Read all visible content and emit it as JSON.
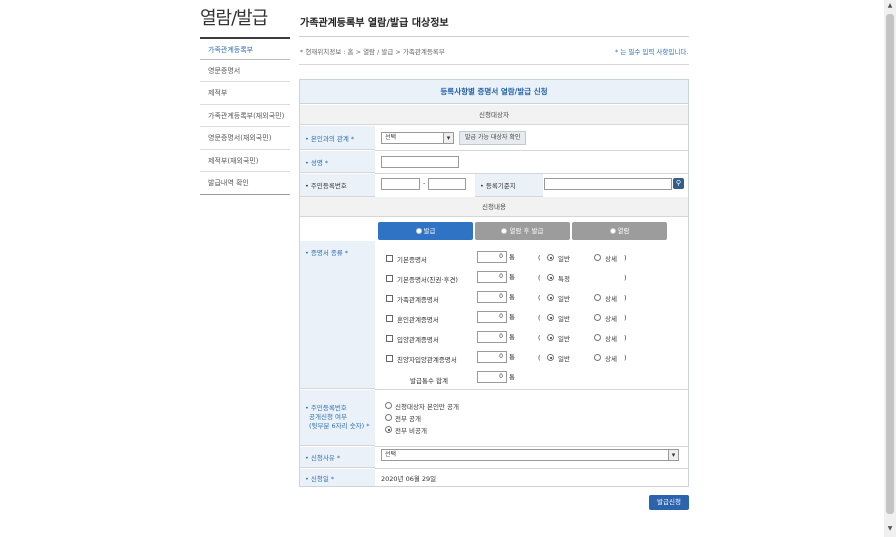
{
  "sidebar": {
    "title": "열람/발급",
    "items": [
      {
        "label": "가족관계등록부"
      },
      {
        "label": "영문증명서"
      },
      {
        "label": "제적부"
      },
      {
        "label": "가족관계등록부(재외국민)"
      },
      {
        "label": "영문증명서(재외국민)"
      },
      {
        "label": "제적부(재외국민)"
      },
      {
        "label": "발급내역 확인"
      }
    ]
  },
  "header": {
    "title": "가족관계등록부 열람/발급 대상정보",
    "breadcrumb": "* 현재위치정보 : 홈 > 열람 / 발급 > 가족관계등록부",
    "required_note": "* 는 필수 입력 사항입니다."
  },
  "form": {
    "title": "등록사항별 증명서 열람/발급 신청",
    "applicant_section": "신청대상자",
    "relation_label": "• 본인과의 관계 *",
    "relation_value": "선택",
    "check_target_button": "발급 가능 대상자 확인",
    "name_label": "• 성명 *",
    "rrn_label": "• 주민등록번호",
    "rrn_dash": "-",
    "reg_base_label": "• 등록기준지",
    "content_section": "신청내용",
    "tabs": [
      {
        "label": "발급"
      },
      {
        "label": "열람 후 발급"
      },
      {
        "label": "열람"
      }
    ],
    "cert_type_label": "• 증명서 종류 *",
    "unit": "통",
    "paren_open": "(",
    "paren_close": ")",
    "option_general": "일반",
    "option_detail": "상세",
    "option_specific": "특정",
    "certs": [
      {
        "name": "기본증명서",
        "count": "0",
        "opt1": "일반",
        "opt2": "상세"
      },
      {
        "name": "기본증명서(친권·후견)",
        "count": "0",
        "opt1": "특정",
        "opt2": ""
      },
      {
        "name": "가족관계증명서",
        "count": "0",
        "opt1": "일반",
        "opt2": "상세"
      },
      {
        "name": "혼인관계증명서",
        "count": "0",
        "opt1": "일반",
        "opt2": "상세"
      },
      {
        "name": "입양관계증명서",
        "count": "0",
        "opt1": "일반",
        "opt2": "상세"
      },
      {
        "name": "친양자입양관계증명서",
        "count": "0",
        "opt1": "일반",
        "opt2": "상세"
      }
    ],
    "total_label": "발급통수 합계",
    "total_count": "0",
    "disclosure_label_1": "• 주민등록번호",
    "disclosure_label_2": "공개신청 여부",
    "disclosure_label_3": "(뒷부분 6자리 숫자) *",
    "disclosure_options": [
      {
        "label": "신청대상자 본인만 공개",
        "selected": false
      },
      {
        "label": "전부 공개",
        "selected": false
      },
      {
        "label": "전부 비공개",
        "selected": true
      }
    ],
    "reason_label": "• 신청사유 *",
    "reason_value": "선택",
    "date_label": "• 신청일 *",
    "date_value": "2020년 06월 29일",
    "submit_button": "발급신청"
  },
  "icons": {
    "search": "search-icon",
    "dropdown": "chevron-down-icon",
    "scroll_up": "scroll-up-icon",
    "scroll_down": "scroll-down-icon"
  },
  "colors": {
    "accent": "#2f73c4",
    "label_bg": "#eaf1f8",
    "submit": "#2c63ad"
  }
}
